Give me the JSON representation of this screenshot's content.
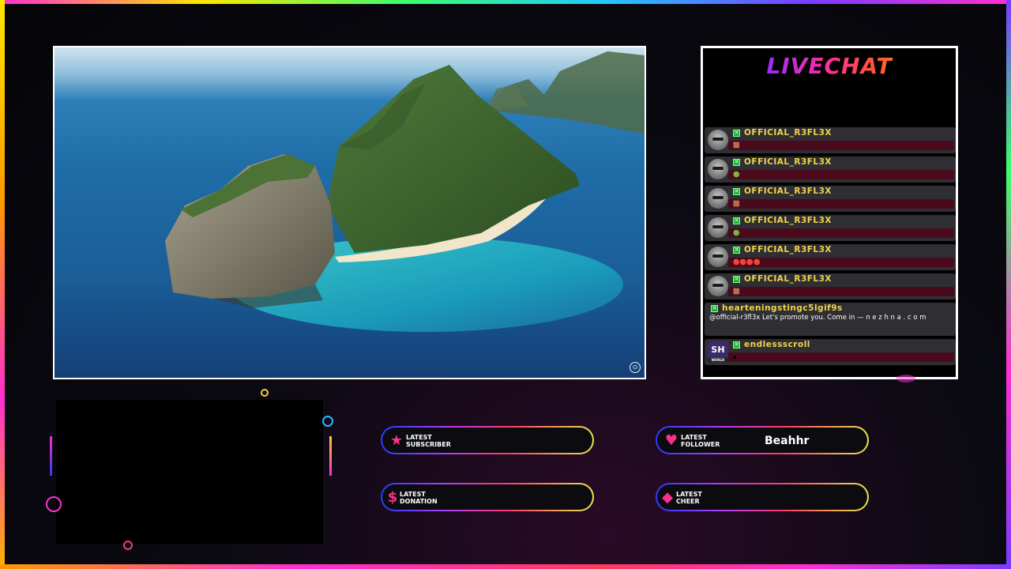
{
  "chat": {
    "title": "LIVECHAT",
    "messages": [
      {
        "user": "OFFICIAL_R3FL3X",
        "emote": "🟫",
        "text": ""
      },
      {
        "user": "OFFICIAL_R3FL3X",
        "emote": "🟢",
        "text": ""
      },
      {
        "user": "OFFICIAL_R3FL3X",
        "emote": "🟫",
        "text": ""
      },
      {
        "user": "OFFICIAL_R3FL3X",
        "emote": "🟢",
        "text": ""
      },
      {
        "user": "OFFICIAL_R3FL3X",
        "emote": "🔴🔴🔴🔴",
        "text": ""
      },
      {
        "user": "OFFICIAL_R3FL3X",
        "emote": "🟫",
        "text": ""
      },
      {
        "user": "hearteningstingc5lgif9s",
        "emote": "",
        "text": "@official-r3fl3x Let's promote you. Come in — n e z h n a . c o m"
      },
      {
        "user": "endlessscroll",
        "emote": "▪",
        "text": "",
        "avatar": "SH",
        "avatar_sub": "WORLD"
      }
    ]
  },
  "alerts": {
    "subscriber": {
      "label_line1": "LATEST",
      "label_line2": "SUBSCRIBER",
      "value": ""
    },
    "follower": {
      "label_line1": "LATEST",
      "label_line2": "FOLLOWER",
      "value": "Beahhr"
    },
    "donation": {
      "label_line1": "LATEST",
      "label_line2": "DONATION",
      "value": ""
    },
    "cheer": {
      "label_line1": "LATEST",
      "label_line2": "CHEER",
      "value": ""
    }
  },
  "icons": {
    "subscriber": "star-icon",
    "follower": "heart-icon",
    "donation": "dollar-icon",
    "cheer": "diamond-icon"
  },
  "colors": {
    "username": "#f2d34a",
    "message_bar": "#4a0a1c",
    "alert_icon": "#ff2f8a"
  }
}
